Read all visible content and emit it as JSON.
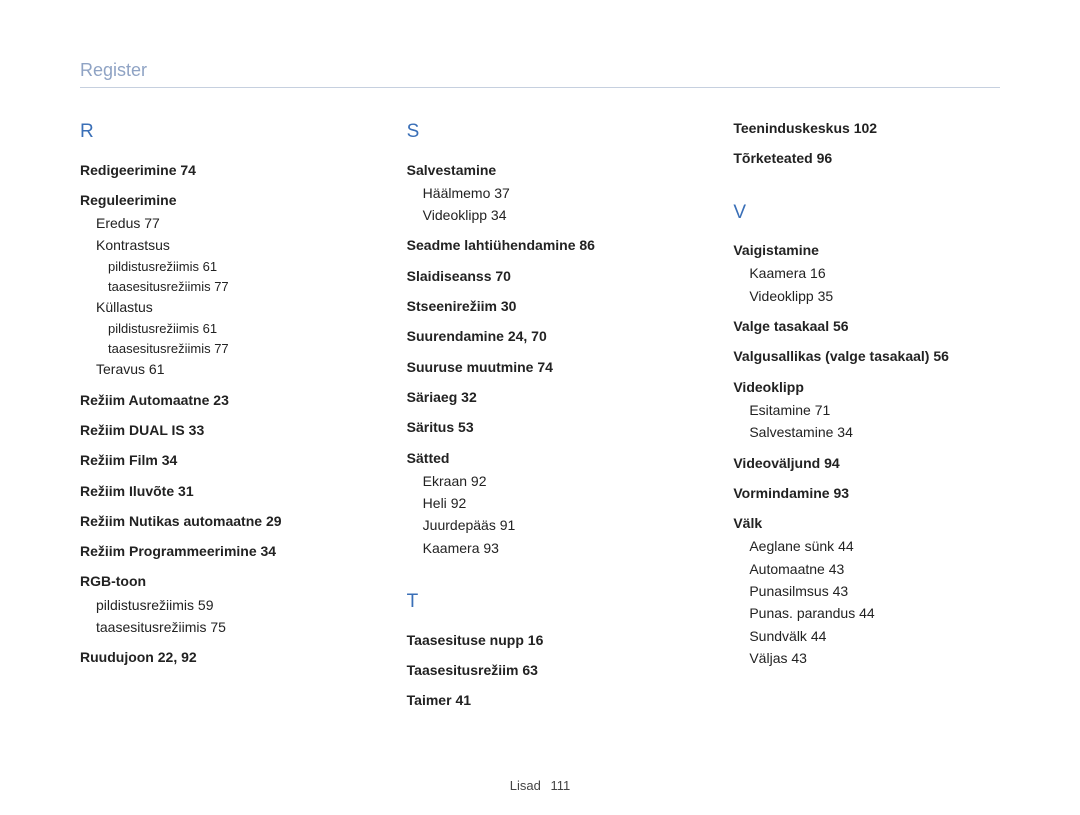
{
  "header": "Register",
  "footer": {
    "label": "Lisad",
    "page": "111"
  },
  "columns": [
    {
      "sections": [
        {
          "letter": "R",
          "entries": [
            {
              "label": "Redigeerimine",
              "pages": "74"
            },
            {
              "label": "Reguleerimine",
              "subs": [
                {
                  "label": "Eredus",
                  "pages": "77"
                },
                {
                  "label": "Kontrastsus",
                  "subs": [
                    {
                      "label": "pildistusrežiimis",
                      "pages": "61"
                    },
                    {
                      "label": "taasesitusrežiimis",
                      "pages": "77"
                    }
                  ]
                },
                {
                  "label": "Küllastus",
                  "subs": [
                    {
                      "label": "pildistusrežiimis",
                      "pages": "61"
                    },
                    {
                      "label": "taasesitusrežiimis",
                      "pages": "77"
                    }
                  ]
                },
                {
                  "label": "Teravus",
                  "pages": "61"
                }
              ]
            },
            {
              "label": "Režiim Automaatne",
              "pages": "23"
            },
            {
              "label": "Režiim DUAL IS",
              "pages": "33"
            },
            {
              "label": "Režiim Film",
              "pages": "34"
            },
            {
              "label": "Režiim Iluvõte",
              "pages": "31"
            },
            {
              "label": "Režiim Nutikas automaatne",
              "pages": "29"
            },
            {
              "label": "Režiim Programmeerimine",
              "pages": "34"
            },
            {
              "label": "RGB-toon",
              "subs": [
                {
                  "label": "pildistusrežiimis",
                  "pages": "59"
                },
                {
                  "label": "taasesitusrežiimis",
                  "pages": "75"
                }
              ]
            },
            {
              "label": "Ruudujoon",
              "pages": "22, 92"
            }
          ]
        }
      ]
    },
    {
      "sections": [
        {
          "letter": "S",
          "entries": [
            {
              "label": "Salvestamine",
              "subs": [
                {
                  "label": "Häälmemo",
                  "pages": "37"
                },
                {
                  "label": "Videoklipp",
                  "pages": "34"
                }
              ]
            },
            {
              "label": "Seadme lahtiühendamine",
              "pages": "86"
            },
            {
              "label": "Slaidiseanss",
              "pages": "70"
            },
            {
              "label": "Stseenirežiim",
              "pages": "30"
            },
            {
              "label": "Suurendamine",
              "pages": "24, 70"
            },
            {
              "label": "Suuruse muutmine",
              "pages": "74"
            },
            {
              "label": "Säriaeg",
              "pages": "32"
            },
            {
              "label": "Säritus",
              "pages": "53"
            },
            {
              "label": "Sätted",
              "subs": [
                {
                  "label": "Ekraan",
                  "pages": "92"
                },
                {
                  "label": "Heli",
                  "pages": "92"
                },
                {
                  "label": "Juurdepääs",
                  "pages": "91"
                },
                {
                  "label": "Kaamera",
                  "pages": "93"
                }
              ]
            }
          ]
        },
        {
          "letter": "T",
          "entries": [
            {
              "label": "Taasesituse nupp",
              "pages": "16"
            },
            {
              "label": "Taasesitusrežiim",
              "pages": "63"
            },
            {
              "label": "Taimer",
              "pages": "41"
            }
          ]
        }
      ]
    },
    {
      "sections": [
        {
          "entries": [
            {
              "label": "Teeninduskeskus",
              "pages": "102"
            },
            {
              "label": "Tõrketeated",
              "pages": "96"
            }
          ]
        },
        {
          "letter": "V",
          "entries": [
            {
              "label": "Vaigistamine",
              "subs": [
                {
                  "label": "Kaamera",
                  "pages": "16"
                },
                {
                  "label": "Videoklipp",
                  "pages": "35"
                }
              ]
            },
            {
              "label": "Valge tasakaal",
              "pages": "56"
            },
            {
              "label": "Valgusallikas (valge tasakaal)",
              "pages": "56"
            },
            {
              "label": "Videoklipp",
              "subs": [
                {
                  "label": "Esitamine",
                  "pages": "71"
                },
                {
                  "label": "Salvestamine",
                  "pages": "34"
                }
              ]
            },
            {
              "label": "Videoväljund",
              "pages": "94"
            },
            {
              "label": "Vormindamine",
              "pages": "93"
            },
            {
              "label": "Välk",
              "subs": [
                {
                  "label": "Aeglane sünk",
                  "pages": "44"
                },
                {
                  "label": "Automaatne",
                  "pages": "43"
                },
                {
                  "label": "Punasilmsus",
                  "pages": "43"
                },
                {
                  "label": "Punas. parandus",
                  "pages": "44"
                },
                {
                  "label": "Sundvälk",
                  "pages": "44"
                },
                {
                  "label": "Väljas",
                  "pages": "43"
                }
              ]
            }
          ]
        }
      ]
    }
  ]
}
